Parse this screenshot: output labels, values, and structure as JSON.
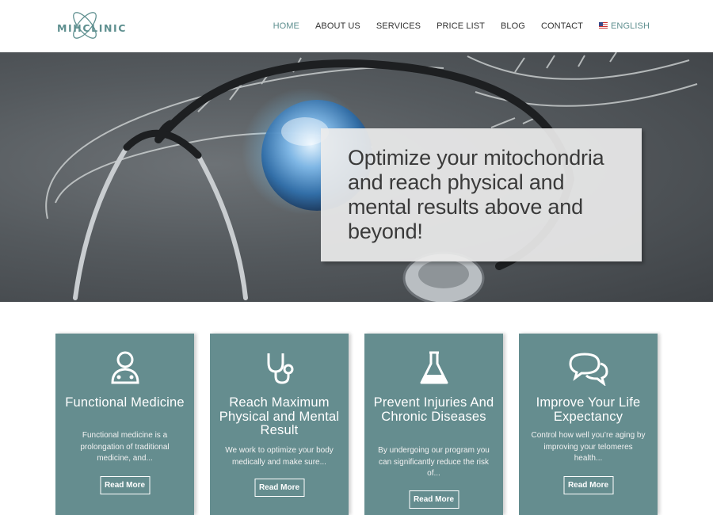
{
  "brand": {
    "name": "MIHCLINIC",
    "accent": "#5e8f8f"
  },
  "nav": {
    "items": [
      {
        "label": "HOME",
        "active": true
      },
      {
        "label": "ABOUT US"
      },
      {
        "label": "SERVICES"
      },
      {
        "label": "PRICE LIST"
      },
      {
        "label": "BLOG"
      },
      {
        "label": "CONTACT"
      }
    ],
    "language": {
      "label": "ENGLISH",
      "icon": "us-flag-icon"
    }
  },
  "hero": {
    "title": "Optimize your mitochondria and reach physical and mental results above and beyond!",
    "image": "stethoscope-and-globe-photo"
  },
  "cards": [
    {
      "icon": "doctor-icon",
      "title": "Functional Medicine",
      "text": "Functional medicine is a prolongation of traditional medicine, and...",
      "button": "Read More"
    },
    {
      "icon": "stethoscope-icon",
      "title": "Reach Maximum Physical and Mental Result",
      "text": "We work to optimize your body medically and make sure...",
      "button": "Read More"
    },
    {
      "icon": "flask-icon",
      "title": "Prevent Injuries And Chronic Diseases",
      "text": "By undergoing our program you can significantly reduce the risk of...",
      "button": "Read More"
    },
    {
      "icon": "chat-bubbles-icon",
      "title": "Improve Your Life Expectancy",
      "text": "Control how well you’re aging by improving your telomeres health...",
      "button": "Read More"
    }
  ],
  "colors": {
    "card_bg": "#658d8f",
    "nav_active": "#5e8f8f"
  }
}
